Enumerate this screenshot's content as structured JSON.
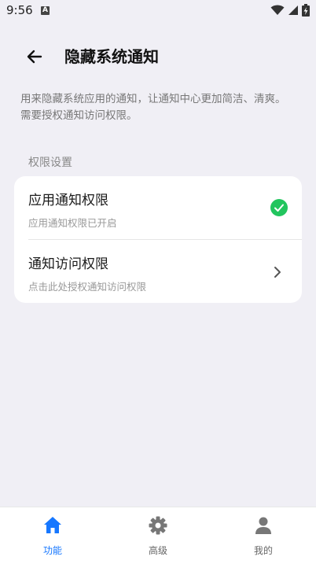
{
  "status_bar": {
    "time": "9:56",
    "notification_icon": "A"
  },
  "header": {
    "title": "隐藏系统通知"
  },
  "description": "用来隐藏系统应用的通知，让通知中心更加简洁、清爽。需要授权通知访问权限。",
  "section": {
    "label": "权限设置"
  },
  "permissions": [
    {
      "title": "应用通知权限",
      "subtitle": "应用通知权限已开启",
      "status": "enabled",
      "icon": "check-circle-icon"
    },
    {
      "title": "通知访问权限",
      "subtitle": "点击此处授权通知访问权限",
      "icon": "chevron-right-icon"
    }
  ],
  "bottom_nav": [
    {
      "label": "功能",
      "icon": "home-icon",
      "active": true
    },
    {
      "label": "高级",
      "icon": "gear-icon",
      "active": false
    },
    {
      "label": "我的",
      "icon": "user-icon",
      "active": false
    }
  ],
  "colors": {
    "accent": "#1677FF",
    "success": "#22C55E",
    "background": "#F0EFF5"
  }
}
